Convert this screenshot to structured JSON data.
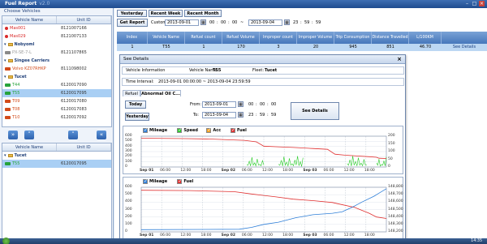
{
  "window": {
    "title": "Fuel Report",
    "version": "v2.0",
    "min": "–",
    "max": "□",
    "close": "×"
  },
  "left": {
    "legend": "Choose Vehicles",
    "col_name": "Vehicle Name",
    "col_unit": "Unit ID",
    "rows": [
      {
        "name": "Mas001",
        "unit": "8121007166",
        "type": "pin",
        "color": "#d92a2a",
        "sel": false,
        "grp": false
      },
      {
        "name": "Mas029",
        "unit": "8121007133",
        "type": "pin",
        "color": "#d92a2a",
        "sel": false,
        "grp": false
      },
      {
        "name": "Nobyoml",
        "unit": "",
        "type": "grp",
        "color": "",
        "sel": false,
        "grp": true
      },
      {
        "name": "PX-SE-7-L",
        "unit": "8121107865",
        "type": "car",
        "color": "#8a8a8a",
        "sel": false,
        "grp": false
      },
      {
        "name": "Singee Carriers",
        "unit": "",
        "type": "grp",
        "color": "",
        "sel": false,
        "grp": true
      },
      {
        "name": "Volvo KZ07RHKP",
        "unit": "8111098002",
        "type": "car",
        "color": "#d24a1a",
        "sel": false,
        "grp": false
      },
      {
        "name": "Tucet",
        "unit": "",
        "type": "grp",
        "color": "",
        "sel": false,
        "grp": true
      },
      {
        "name": "T44",
        "unit": "6120017090",
        "type": "car",
        "color": "#27a33b",
        "sel": false,
        "grp": false
      },
      {
        "name": "T55",
        "unit": "6120017095",
        "type": "car",
        "color": "#27a33b",
        "sel": true,
        "grp": false
      },
      {
        "name": "T09",
        "unit": "6120017080",
        "type": "car",
        "color": "#d24a1a",
        "sel": false,
        "grp": false
      },
      {
        "name": "T08",
        "unit": "6120017083",
        "type": "car",
        "color": "#d24a1a",
        "sel": false,
        "grp": false
      },
      {
        "name": "T10",
        "unit": "6120017092",
        "type": "car",
        "color": "#d24a1a",
        "sel": false,
        "grp": false
      }
    ],
    "col_name2": "Vehicle Name",
    "col_unit2": "Unit ID",
    "rows2": [
      {
        "name": "Tucet",
        "unit": "",
        "type": "grp",
        "color": "",
        "sel": false,
        "grp": true
      },
      {
        "name": "T55",
        "unit": "6120017095",
        "type": "car",
        "color": "#27a33b",
        "sel": true,
        "grp": false
      }
    ]
  },
  "toolbar": {
    "yesterday": "Yesterday",
    "recent_week": "Recent Week",
    "recent_month": "Recent Month",
    "get_report": "Get Report",
    "custom": "Custom:",
    "from_date": "2013-09-01",
    "from_h": "00",
    "from_m": "00",
    "from_s": "00",
    "dash": "~",
    "to_date": "2013-09-04",
    "to_h": "23",
    "to_m": "59",
    "to_s": "59"
  },
  "report": {
    "headers": [
      "Index",
      "Vehicle Name",
      "Refuel count",
      "Refuel Volume",
      "Improper count",
      "Improper Volume",
      "Trip Consumption",
      "Distance Travelled",
      "L/100KM",
      ""
    ],
    "row": [
      "1",
      "T55",
      "1",
      "170",
      "3",
      "20",
      "945",
      "851",
      "46.70",
      "See Details"
    ]
  },
  "popup": {
    "title": "See Details",
    "close": "×",
    "vinfo_label": "Vehicle Information",
    "vname_label": "Vehicle Name:",
    "vname": "T55",
    "fleet_label": "Fleet:",
    "fleet": "Tucet",
    "interval_label": "Time Interval:",
    "interval": "2013-09-01 00:00:00 ~ 2013-09-04 23:59:59",
    "tab_refuel": "Refuel",
    "tab_abnormal": "Abnormal Oil C...",
    "today": "Today",
    "yesterday": "Yesterday",
    "from_label": "From:",
    "to_label": "To:",
    "from_date": "2013-09-01",
    "to_date": "2013-09-04",
    "h1": "00",
    "m1": "00",
    "s1": "00",
    "h2": "23",
    "m2": "59",
    "s2": "59",
    "see_details": "See Details"
  },
  "chart_data": [
    {
      "type": "line",
      "series": [
        {
          "name": "Mileage",
          "color": "#2f7fd8"
        },
        {
          "name": "Speed",
          "color": "#2bcc2b"
        },
        {
          "name": "Acc",
          "color": "#f0a020"
        },
        {
          "name": "Fuel",
          "color": "#e03030"
        }
      ],
      "yleft_ticks": [
        "600",
        "500",
        "400",
        "300",
        "200",
        "100",
        "0"
      ],
      "yright_ticks": [
        "200",
        "150",
        "100",
        "50",
        "0"
      ],
      "xticks": [
        {
          "t": "Sep 01",
          "b": true
        },
        {
          "t": "06:00",
          "b": false
        },
        {
          "t": "12:00",
          "b": false
        },
        {
          "t": "18:00",
          "b": false
        },
        {
          "t": "Sep 02",
          "b": true
        },
        {
          "t": "06:00",
          "b": false
        },
        {
          "t": "12:00",
          "b": false
        },
        {
          "t": "18:00",
          "b": false
        },
        {
          "t": "Sep 03",
          "b": true
        },
        {
          "t": "06:00",
          "b": false
        },
        {
          "t": "12:00",
          "b": false
        },
        {
          "t": "18:00",
          "b": false
        }
      ],
      "fuel": [
        [
          0,
          560
        ],
        [
          0.18,
          552
        ],
        [
          0.28,
          545
        ],
        [
          0.42,
          520
        ],
        [
          0.47,
          490
        ],
        [
          0.5,
          405
        ],
        [
          0.55,
          395
        ],
        [
          0.62,
          380
        ],
        [
          0.7,
          360
        ],
        [
          0.76,
          345
        ],
        [
          0.79,
          250
        ],
        [
          0.83,
          230
        ],
        [
          0.88,
          215
        ],
        [
          0.93,
          200
        ],
        [
          0.96,
          190
        ],
        [
          0.97,
          170
        ],
        [
          1,
          165
        ]
      ],
      "speed_bursts": [
        [
          0.43,
          0.5
        ],
        [
          0.56,
          0.66
        ],
        [
          0.84,
          0.92
        ],
        [
          0.96,
          1.0
        ]
      ]
    },
    {
      "type": "line",
      "series": [
        {
          "name": "Mileage",
          "color": "#2f7fd8"
        },
        {
          "name": "Fuel",
          "color": "#e03030"
        }
      ],
      "yleft_ticks": [
        "600",
        "500",
        "400",
        "300",
        "200",
        "100",
        "0"
      ],
      "yright_ticks": [
        "148,800",
        "148,700",
        "148,600",
        "148,500",
        "148,400",
        "148,300",
        "148,200"
      ],
      "xticks": [
        {
          "t": "Sep 01",
          "b": true
        },
        {
          "t": "06:00",
          "b": false
        },
        {
          "t": "12:00",
          "b": false
        },
        {
          "t": "18:00",
          "b": false
        },
        {
          "t": "Sep 02",
          "b": true
        },
        {
          "t": "06:00",
          "b": false
        },
        {
          "t": "12:00",
          "b": false
        },
        {
          "t": "18:00",
          "b": false
        },
        {
          "t": "Sep 03",
          "b": true
        },
        {
          "t": "06:00",
          "b": false
        },
        {
          "t": "12:00",
          "b": false
        },
        {
          "t": "18:00",
          "b": false
        }
      ],
      "fuel": [
        [
          0,
          560
        ],
        [
          0.2,
          555
        ],
        [
          0.38,
          540
        ],
        [
          0.45,
          510
        ],
        [
          0.5,
          490
        ],
        [
          0.55,
          470
        ],
        [
          0.62,
          440
        ],
        [
          0.7,
          420
        ],
        [
          0.78,
          395
        ],
        [
          0.8,
          380
        ],
        [
          0.87,
          330
        ],
        [
          0.93,
          250
        ],
        [
          0.96,
          200
        ],
        [
          1,
          180
        ]
      ],
      "mileage": [
        [
          0,
          148230
        ],
        [
          0.4,
          148235
        ],
        [
          0.45,
          148260
        ],
        [
          0.5,
          148300
        ],
        [
          0.56,
          148330
        ],
        [
          0.63,
          148390
        ],
        [
          0.7,
          148430
        ],
        [
          0.78,
          148450
        ],
        [
          0.82,
          148470
        ],
        [
          0.86,
          148530
        ],
        [
          0.9,
          148600
        ],
        [
          0.95,
          148680
        ],
        [
          0.97,
          148720
        ],
        [
          1,
          148780
        ]
      ]
    }
  ],
  "taskbar": {
    "clock": "14:35"
  }
}
